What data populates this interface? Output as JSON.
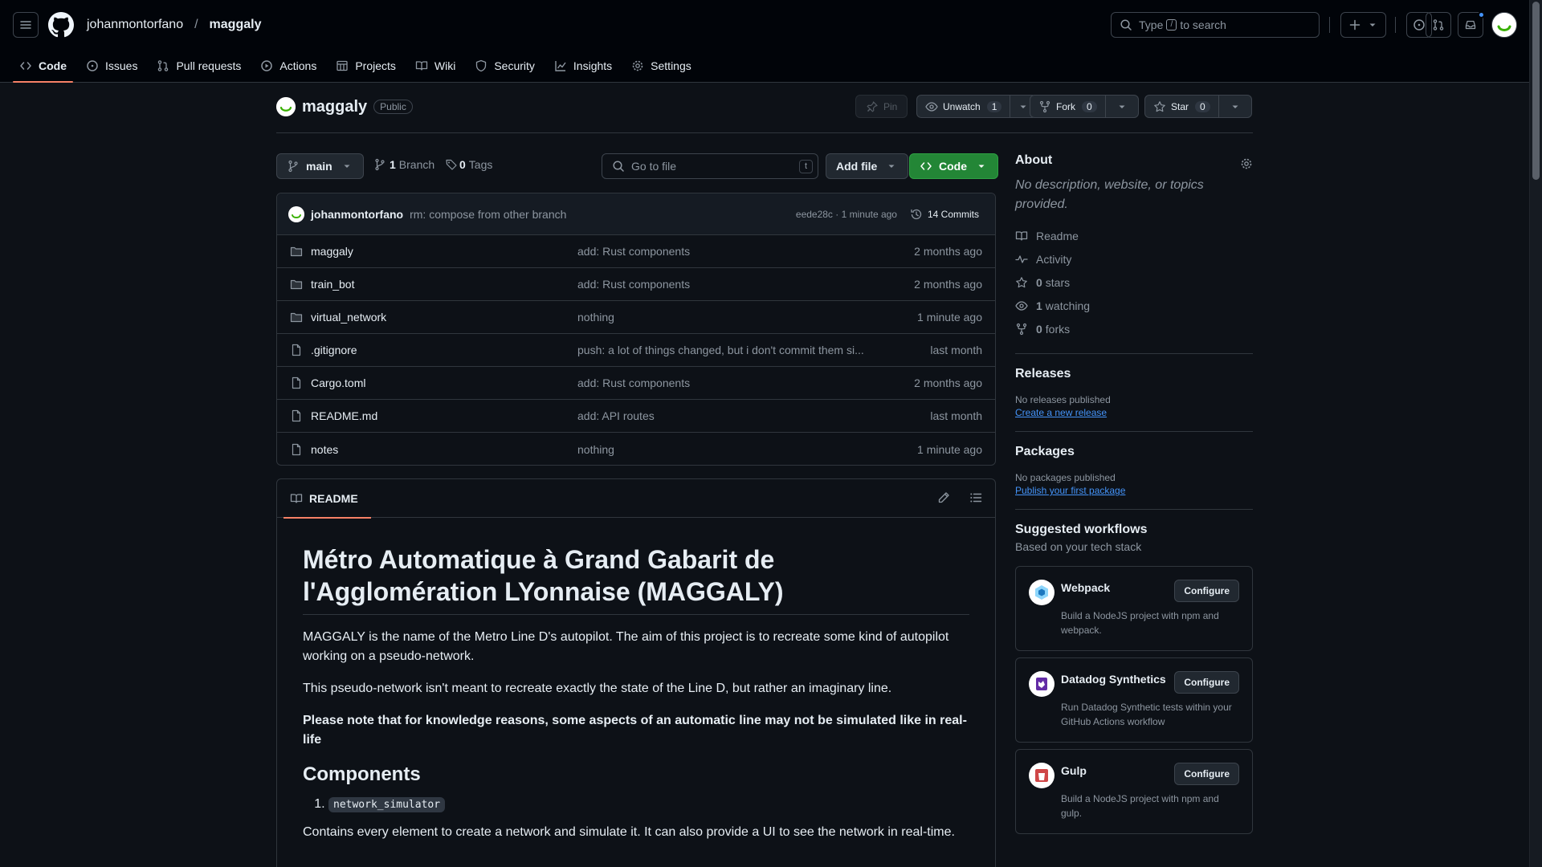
{
  "header": {
    "owner": "johanmontorfano",
    "separator": "/",
    "repo": "maggaly",
    "search_prefix": "Type",
    "search_key": "/",
    "search_suffix": "to search",
    "icons": [
      "menu-icon",
      "github-logo-icon",
      "search-icon",
      "plus-icon",
      "issue-icon",
      "pull-request-icon",
      "inbox-icon"
    ],
    "notification_color": "#4493f8"
  },
  "tabs": [
    {
      "label": "Code",
      "icon": "code-icon",
      "active": true
    },
    {
      "label": "Issues",
      "icon": "issue-icon"
    },
    {
      "label": "Pull requests",
      "icon": "pull-request-icon"
    },
    {
      "label": "Actions",
      "icon": "play-icon"
    },
    {
      "label": "Projects",
      "icon": "table-icon"
    },
    {
      "label": "Wiki",
      "icon": "book-icon"
    },
    {
      "label": "Security",
      "icon": "shield-icon"
    },
    {
      "label": "Insights",
      "icon": "graph-icon"
    },
    {
      "label": "Settings",
      "icon": "gear-icon"
    }
  ],
  "repo_header": {
    "name": "maggaly",
    "visibility": "Public",
    "pin_label": "Pin",
    "unwatch_label": "Unwatch",
    "watch_count": "1",
    "fork_label": "Fork",
    "fork_count": "0",
    "star_label": "Star",
    "star_count": "0"
  },
  "toolbar": {
    "branch": "main",
    "branch_count": "1",
    "branch_label": "Branch",
    "tag_count": "0",
    "tag_label": "Tags",
    "go_to_file_placeholder": "Go to file",
    "go_to_file_key": "t",
    "add_file_label": "Add file",
    "code_label": "Code"
  },
  "latest_commit": {
    "author": "johanmontorfano",
    "message": "rm: compose from other branch",
    "hash_time": "eede28c · 1 minute ago",
    "commits_label": "14 Commits"
  },
  "files": [
    {
      "name": "maggaly",
      "type": "dir",
      "message": "add: Rust components",
      "when": "2 months ago"
    },
    {
      "name": "train_bot",
      "type": "dir",
      "message": "add: Rust components",
      "when": "2 months ago"
    },
    {
      "name": "virtual_network",
      "type": "dir",
      "message": "nothing",
      "when": "1 minute ago"
    },
    {
      "name": ".gitignore",
      "type": "file",
      "message": "push: a lot of things changed, but i don't commit them si...",
      "when": "last month"
    },
    {
      "name": "Cargo.toml",
      "type": "file",
      "message": "add: Rust components",
      "when": "2 months ago"
    },
    {
      "name": "README.md",
      "type": "file",
      "message": "add: API routes",
      "when": "last month"
    },
    {
      "name": "notes",
      "type": "file",
      "message": "nothing",
      "when": "1 minute ago"
    }
  ],
  "readme": {
    "tab_label": "README",
    "title": "Métro Automatique à Grand Gabarit de l'Agglomération LYonnaise (MAGGALY)",
    "p1": "MAGGALY is the name of the Metro Line D's autopilot. The aim of this project is to recreate some kind of autopilot working on a pseudo-network.",
    "p2": "This pseudo-network isn't meant to recreate exactly the state of the Line D, but rather an imaginary line.",
    "p3": "Please note that for knowledge reasons, some aspects of an automatic line may not be simulated like in real-life",
    "h2": "Components",
    "list_item_1": "network_simulator",
    "p4": "Contains every element to create a network and simulate it. It can also provide a UI to see the network in real-time."
  },
  "about": {
    "title": "About",
    "description": "No description, website, or topics provided.",
    "readme_label": "Readme",
    "activity_label": "Activity",
    "stars_count": "0",
    "stars_label": "stars",
    "watching_count": "1",
    "watching_label": "watching",
    "forks_count": "0",
    "forks_label": "forks"
  },
  "releases": {
    "title": "Releases",
    "empty": "No releases published",
    "link": "Create a new release"
  },
  "packages": {
    "title": "Packages",
    "empty": "No packages published",
    "link": "Publish your first package"
  },
  "workflows": {
    "title": "Suggested workflows",
    "subtitle": "Based on your tech stack",
    "configure_label": "Configure",
    "items": [
      {
        "name": "Webpack",
        "desc": "Build a NodeJS project with npm and webpack.",
        "icon": "webpack-icon",
        "color": "#8ed6fb"
      },
      {
        "name": "Datadog Synthetics",
        "desc": "Run Datadog Synthetic tests within your GitHub Actions workflow",
        "icon": "datadog-icon",
        "color": "#632ca6"
      },
      {
        "name": "Gulp",
        "desc": "Build a NodeJS project with npm and gulp.",
        "icon": "gulp-icon",
        "color": "#cf4647"
      }
    ]
  },
  "colors": {
    "background": "#0d1117",
    "header": "#010409",
    "accent_link": "#4493f8",
    "primary_button": "#238636",
    "active_tab_underline": "#f78166"
  }
}
